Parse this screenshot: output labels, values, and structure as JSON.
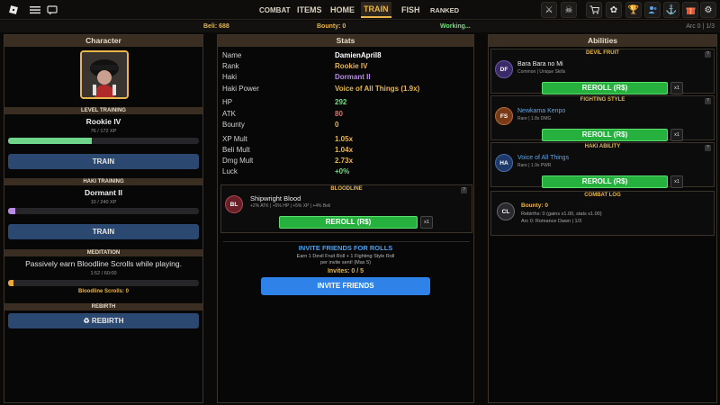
{
  "topbar": {
    "nav": [
      "COMBAT",
      "ITEMS",
      "HOME",
      "TRAIN",
      "FISH",
      "RANKED"
    ],
    "active_tab": "TRAIN",
    "icons_left": [
      "roblox-logo-icon",
      "hamburger-menu-icon",
      "chat-icon"
    ],
    "icons_right": [
      "crossed-swords-icon",
      "skull-flag-icon",
      "cart-icon",
      "settings-gear-icon",
      "trophy-icon",
      "users-icon",
      "anchor-icon",
      "gift-icon",
      "gear-icon"
    ]
  },
  "status": {
    "beli": "Beli: 688",
    "bounty": "Bounty: 0",
    "working": "Working...",
    "arc": "Arc 0 | 1/3"
  },
  "character": {
    "title": "Character",
    "level_section": "LEVEL TRAINING",
    "level_rank": "Rookie IV",
    "level_xp": "76 / 172 XP",
    "level_progress": 0.44,
    "train_label": "TRAIN",
    "haki_section": "HAKI TRAINING",
    "haki_rank": "Dormant II",
    "haki_xp": "10 / 240 XP",
    "haki_progress": 0.04,
    "train2_label": "TRAIN",
    "meditation_section": "MEDITATION",
    "meditation_text": "Passively earn Bloodline Scrolls while playing.",
    "meditation_time": "1:52 / 60:00",
    "meditation_progress": 0.03,
    "scrolls": "Bloodline Scrolls: 0",
    "rebirth_section": "REBIRTH",
    "rebirth_label": "♻ REBIRTH"
  },
  "stats": {
    "title": "Stats",
    "rows": [
      {
        "label": "Name",
        "value": "DamienApril8",
        "color": "#ffffff"
      },
      {
        "label": "Rank",
        "value": "Rookie IV",
        "color": "#e8b64a"
      },
      {
        "label": "Haki",
        "value": "Dormant II",
        "color": "#b98ae8"
      },
      {
        "label": "Haki Power",
        "value": "Voice of All Things (1.9x)",
        "color": "#e8b64a"
      },
      {
        "label": "HP",
        "value": "292",
        "color": "#6ee07a"
      },
      {
        "label": "ATK",
        "value": "80",
        "color": "#f06a5a"
      },
      {
        "label": "Bounty",
        "value": "0",
        "color": "#e8b64a"
      },
      {
        "label": "XP Mult",
        "value": "1.05x",
        "color": "#e8b64a"
      },
      {
        "label": "Beli Mult",
        "value": "1.04x",
        "color": "#e8b64a"
      },
      {
        "label": "Dmg Mult",
        "value": "2.73x",
        "color": "#e8b64a"
      },
      {
        "label": "Luck",
        "value": "+0%",
        "color": "#6ee07a"
      }
    ],
    "bloodline": {
      "section": "BLOODLINE",
      "badge": "BL",
      "name": "Shipwright Blood",
      "desc": "+2% ATK | +5% HP | +5% XP | +4% Beli",
      "reroll": "REROLL (R$)",
      "x1": "x1"
    },
    "invite": {
      "title": "INVITE FRIENDS FOR ROLLS",
      "line1": "Earn 1 Devil Fruit Roll + 1 Fighting Style Roll",
      "line2": "per invite sent! (Max 5)",
      "count": "Invites: 0 / 5",
      "button": "INVITE FRIENDS"
    }
  },
  "abilities": {
    "title": "Abilities",
    "devil_fruit": {
      "section": "DEVIL FRUIT",
      "badge": "DF",
      "name": "Bara Bara no Mi",
      "sub": "Common | Unique Skills",
      "reroll": "REROLL (R$)",
      "x1": "x1"
    },
    "fighting_style": {
      "section": "FIGHTING STYLE",
      "badge": "FS",
      "name": "Newkama Kenpo",
      "sub": "Rare | 1.8x DMG",
      "reroll": "REROLL (R$)",
      "x1": "x1"
    },
    "haki_ability": {
      "section": "HAKI ABILITY",
      "badge": "HA",
      "name": "Voice of All Things",
      "sub": "Rare | 1.9x PWR",
      "reroll": "REROLL (R$)",
      "x1": "x1"
    },
    "combat_log": {
      "section": "COMBAT LOG",
      "badge": "CL",
      "bounty": "Bounty: 0",
      "rebirths": "Rebirths: 0 (gains x1.00, stats x1.00)",
      "arc": "Arc 0: Romance Dawn | 1/3"
    }
  },
  "colors": {
    "accent_gold": "#e8b64a",
    "green": "#26b13e",
    "blue_btn": "#2f82e8",
    "panel_header": "#3a2e22"
  }
}
